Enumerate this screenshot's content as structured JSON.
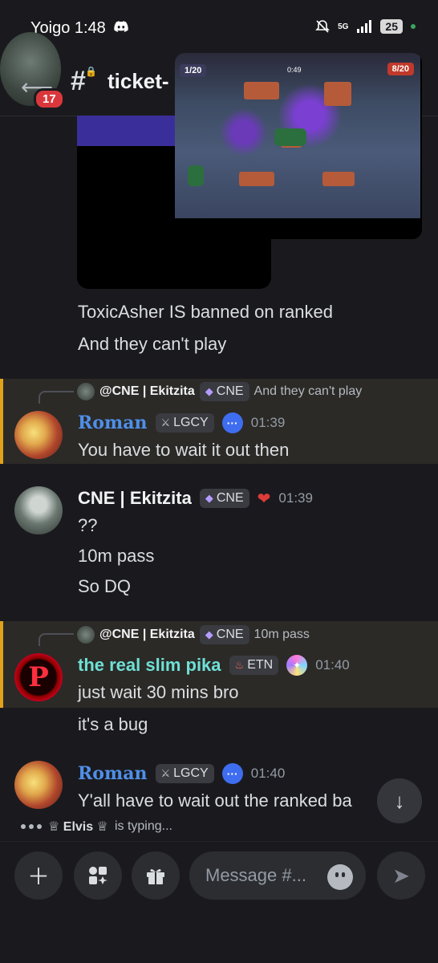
{
  "status_bar": {
    "time": "Yoigo 1:48",
    "network": "5G",
    "battery": "25"
  },
  "header": {
    "unread_count": "17",
    "channel_name": "ticket-"
  },
  "pip": {
    "score_left": "1/20",
    "timer": "0:49",
    "score_right": "8/20"
  },
  "messages": {
    "block1": {
      "line1": "ToxicAsher IS banned on ranked",
      "line2": "And they can't play"
    },
    "roman1": {
      "reply_to": "@CNE | Ekitzita",
      "reply_tag": "CNE",
      "reply_text": "And they can't play",
      "author": "Roman",
      "tag": "LGCY",
      "time": "01:39",
      "text": "You have to wait it out then"
    },
    "cne1": {
      "author": "CNE | Ekitzita",
      "tag": "CNE",
      "time": "01:39",
      "line1": "??",
      "line2": "10m pass",
      "line3": "So DQ"
    },
    "pika1": {
      "reply_to": "@CNE | Ekitzita",
      "reply_tag": "CNE",
      "reply_text": "10m pass",
      "author": "the real slim pika",
      "tag": "ETN",
      "time": "01:40",
      "text": "just wait 30 mins bro",
      "text2": "it's a bug"
    },
    "roman2": {
      "author": "Roman",
      "tag": "LGCY",
      "time": "01:40",
      "text": "Y'all have to wait out the ranked ba"
    }
  },
  "typing": {
    "user": "♕ Elvis ♕",
    "suffix": "is typing..."
  },
  "composer": {
    "placeholder": "Message #..."
  },
  "colors": {
    "background": "#1a1a1e",
    "highlight_bar": "#e0a21a",
    "roman_name": "#4f8fe8",
    "pika_name": "#6fe0d6"
  }
}
